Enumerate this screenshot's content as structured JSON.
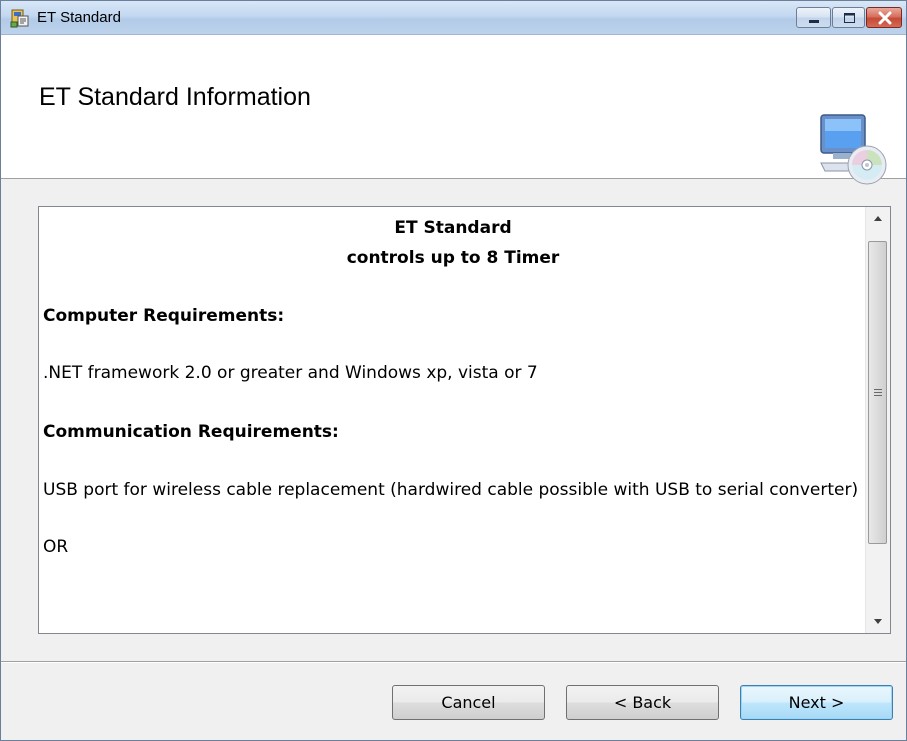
{
  "window": {
    "title": "ET Standard",
    "controls": {
      "minimize_icon": "minimize-icon",
      "maximize_icon": "maximize-icon",
      "close_icon": "close-icon"
    }
  },
  "banner": {
    "title": "ET Standard Information",
    "icon": "computer-disc-icon"
  },
  "info": {
    "product_name": "ET Standard",
    "product_subtitle": "controls up to 8 Timer",
    "computer_requirements_heading": "Computer Requirements:",
    "computer_requirements_text": ".NET framework 2.0 or greater and Windows xp, vista or 7",
    "communication_requirements_heading": "Communication Requirements:",
    "communication_requirements_text": "USB port for wireless cable replacement (hardwired cable possible with USB to serial converter)",
    "or_text": "OR"
  },
  "buttons": {
    "cancel": "Cancel",
    "back": "< Back",
    "next": "Next >"
  },
  "colors": {
    "titlebar": "#c3d8f0",
    "close_button": "#c44a36",
    "default_button_border": "#3c7fb1"
  }
}
